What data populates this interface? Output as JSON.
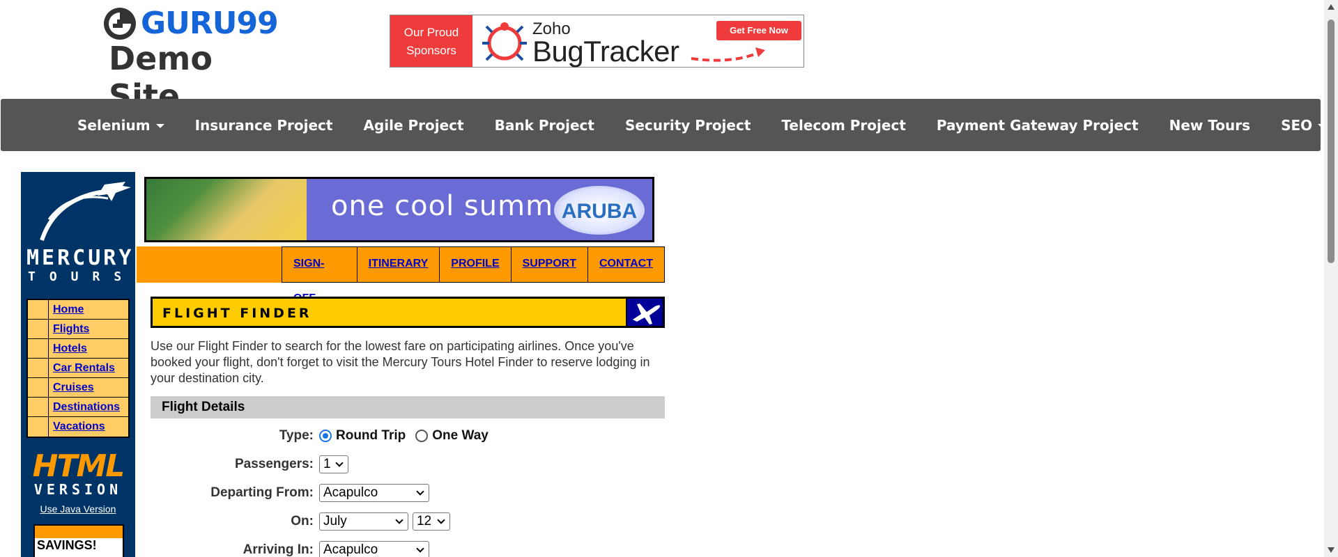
{
  "header": {
    "logo_text": "GURU99",
    "logo_sub": "Demo Site",
    "sponsor": {
      "line1": "Our Proud",
      "line2": "Sponsors",
      "brand_small": "Zoho",
      "brand_big": "BugTracker",
      "cta": "Get Free Now"
    }
  },
  "nav": {
    "items": [
      {
        "label": "Selenium",
        "dropdown": true
      },
      {
        "label": "Insurance Project",
        "dropdown": false
      },
      {
        "label": "Agile Project",
        "dropdown": false
      },
      {
        "label": "Bank Project",
        "dropdown": false
      },
      {
        "label": "Security Project",
        "dropdown": false
      },
      {
        "label": "Telecom Project",
        "dropdown": false
      },
      {
        "label": "Payment Gateway Project",
        "dropdown": false
      },
      {
        "label": "New Tours",
        "dropdown": false
      },
      {
        "label": "SEO",
        "dropdown": true
      }
    ]
  },
  "mercury": {
    "name": "MERCURY",
    "tours": "TOURS",
    "menu": [
      "Home",
      "Flights",
      "Hotels",
      "Car Rentals",
      "Cruises",
      "Destinations",
      "Vacations"
    ],
    "html_big": "HTML",
    "html_sub": "VERSION",
    "java_link": "Use Java Version",
    "savings": "SAVINGS!",
    "banner_text": "one cool summer",
    "banner_brand": "ARUBA",
    "top_links": [
      "SIGN-OFF",
      "ITINERARY",
      "PROFILE",
      "SUPPORT",
      "CONTACT"
    ]
  },
  "finder": {
    "title": "FLIGHT FINDER",
    "intro": "Use our Flight Finder to search for the lowest fare on participating airlines. Once you've booked your flight, don't forget to visit the Mercury Tours Hotel Finder to reserve lodging in your destination city.",
    "section": "Flight Details",
    "type_label": "Type:",
    "round_trip": "Round Trip",
    "one_way": "One Way",
    "passengers_label": "Passengers:",
    "passengers_value": "1",
    "departing_label": "Departing From:",
    "departing_value": "Acapulco",
    "on_label": "On:",
    "on_month": "July",
    "on_day": "12",
    "arriving_label": "Arriving In:",
    "arriving_value": "Acapulco"
  },
  "colors": {
    "nav_bg": "#555555",
    "mercury_blue": "#003366",
    "orange": "#ff9900",
    "yellow": "#ffcc00",
    "link_blue": "#0000cc"
  }
}
